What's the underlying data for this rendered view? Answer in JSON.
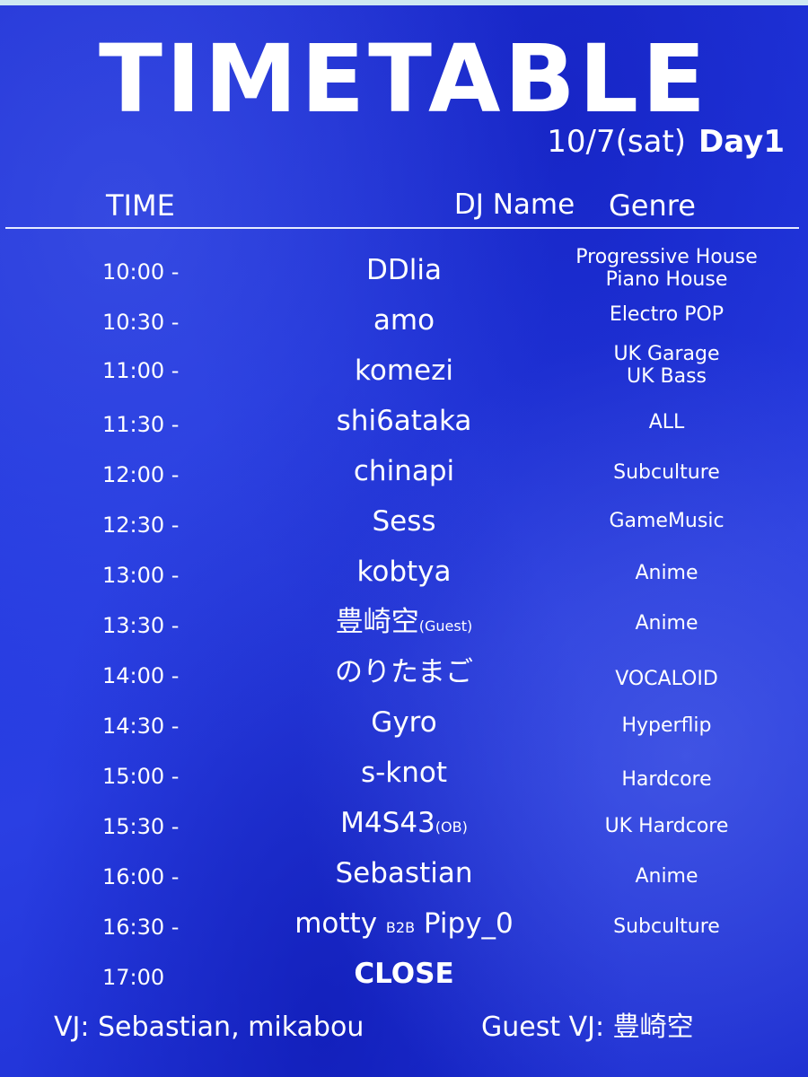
{
  "title": "TIMETABLE",
  "date": "10/7(sat)",
  "day": "Day1",
  "headers": {
    "time": "TIME",
    "dj": "DJ Name",
    "genre": "Genre"
  },
  "rows": [
    {
      "time": "10:00 -",
      "dj": "DDlia",
      "genre1": "Progressive House",
      "genre2": "Piano House"
    },
    {
      "time": "10:30 -",
      "dj": "amo",
      "genre1": "Electro POP",
      "genre2": ""
    },
    {
      "time": "11:00 -",
      "dj": "komezi",
      "genre1": "UK Garage",
      "genre2": "UK Bass"
    },
    {
      "time": "11:30 -",
      "dj": "shi6ataka",
      "genre1": "ALL",
      "genre2": ""
    },
    {
      "time": "12:00 -",
      "dj": "chinapi",
      "genre1": "Subculture",
      "genre2": ""
    },
    {
      "time": "12:30 -",
      "dj": "Sess",
      "genre1": "GameMusic",
      "genre2": ""
    },
    {
      "time": "13:00 -",
      "dj": "kobtya",
      "genre1": "Anime",
      "genre2": ""
    },
    {
      "time": "13:30 -",
      "dj": "豊崎空",
      "dj_note": "(Guest)",
      "genre1": "Anime",
      "genre2": ""
    },
    {
      "time": "14:00 -",
      "dj": "のりたまご",
      "genre1": "VOCALOID",
      "genre2": ""
    },
    {
      "time": "14:30 -",
      "dj": "Gyro",
      "genre1": "Hyperflip",
      "genre2": ""
    },
    {
      "time": "15:00 -",
      "dj": "s-knot",
      "genre1": "Hardcore",
      "genre2": ""
    },
    {
      "time": "15:30 -",
      "dj": "M4S43",
      "dj_note": "(OB)",
      "genre1": "UK Hardcore",
      "genre2": ""
    },
    {
      "time": "16:00 -",
      "dj": "Sebastian",
      "genre1": "Anime",
      "genre2": ""
    },
    {
      "time": "16:30 -",
      "dj": "motty",
      "dj_b2b": "B2B",
      "dj_partner": "Pipy_0",
      "genre1": "Subculture",
      "genre2": ""
    }
  ],
  "close": {
    "time": "17:00",
    "label": "CLOSE"
  },
  "footer": {
    "vj": "VJ: Sebastian, mikabou",
    "guest_vj": "Guest VJ: 豊崎空"
  }
}
